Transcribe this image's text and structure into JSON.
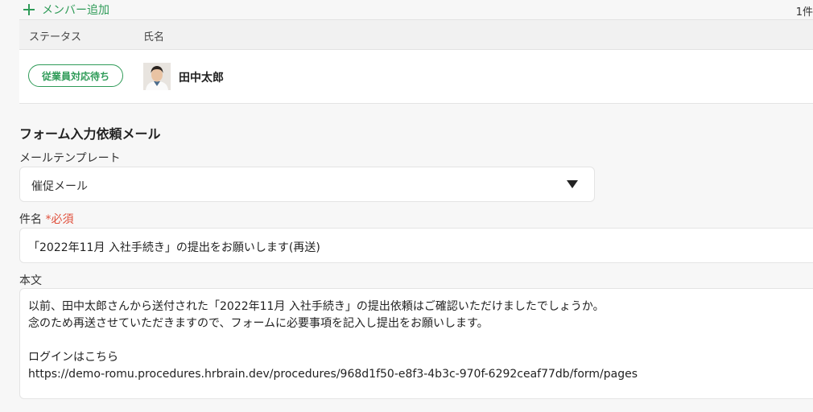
{
  "toolbar": {
    "add_member_label": "メンバー追加",
    "count_label": "1件"
  },
  "table": {
    "headers": {
      "status": "ステータス",
      "name": "氏名"
    },
    "rows": [
      {
        "status": "従業員対応待ち",
        "name": "田中太郎"
      }
    ]
  },
  "form": {
    "section_title": "フォーム入力依頼メール",
    "template_label": "メールテンプレート",
    "template_value": "催促メール",
    "subject_label": "件名",
    "subject_required": "*必須",
    "subject_value": "「2022年11月 入社手続き」の提出をお願いします(再送)",
    "body_label": "本文",
    "body_lines": [
      "以前、田中太郎さんから送付された「2022年11月 入社手続き」の提出依頼はご確認いただけましたでしょうか。",
      "念のため再送させていただきますので、フォームに必要事項を記入し提出をお願いします。",
      "",
      "ログインはこちら",
      "https://demo-romu.procedures.hrbrain.dev/procedures/968d1f50-e8f3-4b3c-970f-6292ceaf77db/form/pages"
    ]
  },
  "colors": {
    "accent": "#2f9b58",
    "required": "#e0503c"
  }
}
